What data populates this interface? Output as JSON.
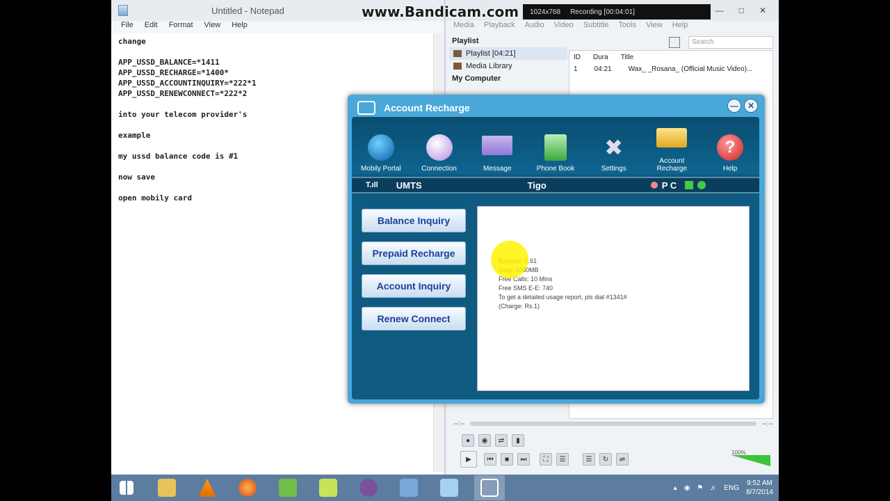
{
  "bandicam": {
    "watermark": "www.Bandicam.com",
    "resolution": "1024x768",
    "recording": "Recording [00:04:01]"
  },
  "notepad": {
    "title": "Untitled - Notepad",
    "menu": [
      "File",
      "Edit",
      "Format",
      "View",
      "Help"
    ],
    "lines": "change\n\nAPP_USSD_BALANCE=*1411\nAPP_USSD_RECHARGE=*1400*\nAPP_USSD_ACCOUNTINQUIRY=*222*1\nAPP_USSD_RENEWCONNECT=*222*2\n\ninto your telecom provider's\n\nexample\n\nmy ussd balance code is #1\n\nnow save\n\nopen mobily card"
  },
  "vlc": {
    "menu": [
      "Media",
      "Playback",
      "Audio",
      "Video",
      "Subtitle",
      "Tools",
      "View",
      "Help"
    ],
    "side_header": "Playlist",
    "side_items": [
      "Playlist [04:21]",
      "Media Library"
    ],
    "side_header2": "My Computer",
    "search_placeholder": "Search",
    "columns": [
      "ID",
      "Dura",
      "Title"
    ],
    "row": {
      "id": "1",
      "dur": "04:21",
      "title": "Wax_ _Rosana_ (Official Music Video)..."
    },
    "time_left": "--:--",
    "time_right": "--:--",
    "volume": "100%"
  },
  "dialog": {
    "title": "Account Recharge",
    "toolbar": [
      "Mobily Portal",
      "Connection",
      "Message",
      "Phone Book",
      "Settings",
      "Account Recharge",
      "Help"
    ],
    "status": {
      "network": "UMTS",
      "operator": "Tigo",
      "pc": "P C"
    },
    "buttons": [
      "Balance Inquiry",
      "Prepaid Recharge",
      "Account Inquiry",
      "Renew Connect"
    ],
    "response": [
      "Balance: 1.61",
      "Data: 1060MB",
      "Free Calls: 10 Mins",
      "Free SMS E-E: 740",
      "To get a detailed usage report, pls dial #1341#",
      "(Charge: Rs.1)"
    ]
  },
  "taskbar": {
    "lang": "ENG",
    "time": "9:52 AM",
    "date": "8/7/2014"
  }
}
